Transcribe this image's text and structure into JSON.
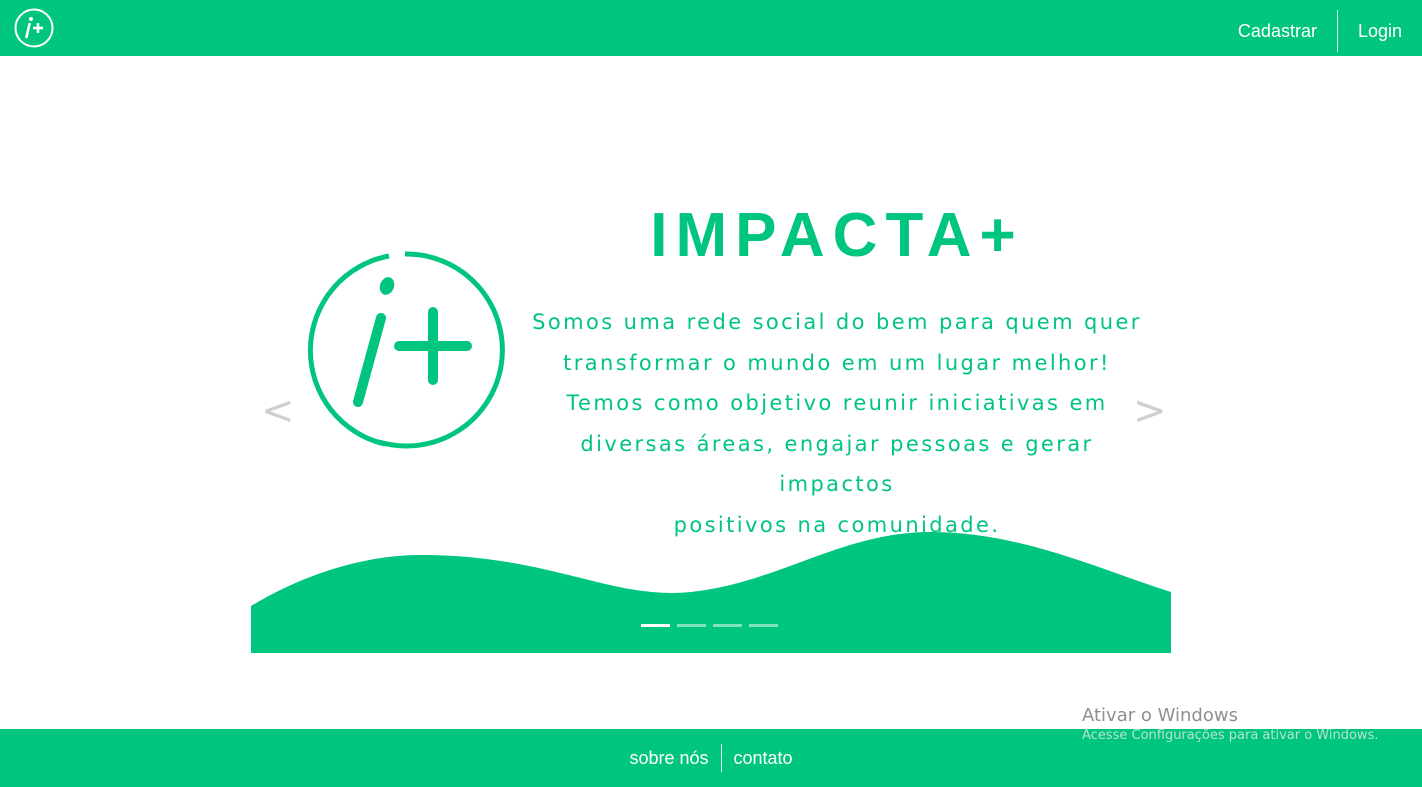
{
  "header": {
    "logo_icon": "i-plus-logo-icon",
    "nav": [
      "Cadastrar",
      "Login"
    ]
  },
  "carousel": {
    "title": "IMPACTA+",
    "lines": [
      "Somos uma rede social do bem para quem quer",
      "transformar o mundo em um lugar melhor!",
      "Temos como objetivo reunir iniciativas em",
      "diversas áreas, engajar pessoas e gerar impactos",
      "positivos na comunidade."
    ],
    "prev_label": "<",
    "next_label": ">",
    "indicator_count": 4,
    "active_indicator": 1
  },
  "footer": {
    "links": [
      "sobre nós",
      "contato"
    ]
  },
  "watermark": {
    "title": "Ativar o Windows",
    "subtitle": "Acesse Configurações para ativar o Windows."
  },
  "colors": {
    "brand": "#00c57e",
    "arrow": "#cfcfcf"
  }
}
